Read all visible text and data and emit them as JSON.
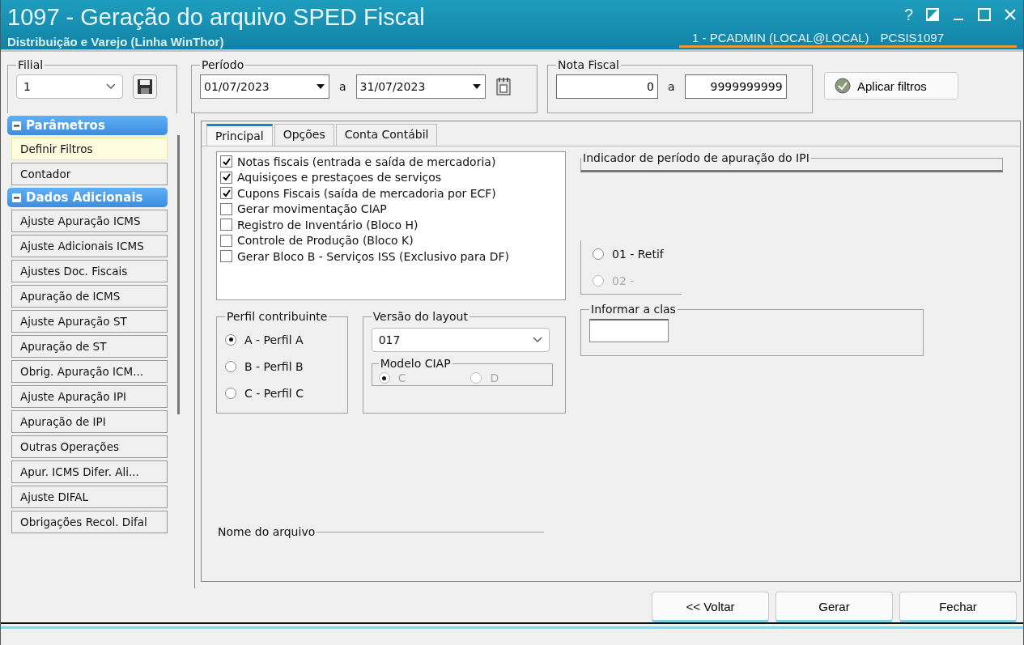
{
  "window": {
    "title": "1097 - Geração do arquivo SPED Fiscal",
    "subtitle": "Distribuição e Varejo (Linha WinThor)",
    "user": "1 - PCADMIN (LOCAL@LOCAL)",
    "program": "PCSIS1097",
    "help": "?"
  },
  "filters": {
    "filial": {
      "label": "Filial",
      "value": "1"
    },
    "periodo": {
      "label": "Período",
      "from": "01/07/2023",
      "separator": "a",
      "to": "31/07/2023"
    },
    "nota_fiscal": {
      "label": "Nota Fiscal",
      "from": "0",
      "separator": "a",
      "to": "9999999999"
    },
    "apply_button": "Aplicar filtros"
  },
  "sidebar": [
    {
      "title": "Parâmetros",
      "expanded": true,
      "items": [
        {
          "label": "Definir Filtros",
          "selected": true
        },
        {
          "label": "Contador",
          "selected": false
        }
      ]
    },
    {
      "title": "Dados Adicionais",
      "expanded": true,
      "items": [
        {
          "label": "Ajuste Apuração ICMS",
          "selected": false
        },
        {
          "label": "Ajuste Adicionais ICMS",
          "selected": false
        },
        {
          "label": "Ajustes Doc. Fiscais",
          "selected": false
        },
        {
          "label": "Apuração de ICMS",
          "selected": false
        },
        {
          "label": "Ajuste Apuração ST",
          "selected": false
        },
        {
          "label": "Apuração de ST",
          "selected": false
        },
        {
          "label": "Obrig. Apuração ICM...",
          "selected": false
        },
        {
          "label": "Ajuste Apuração IPI",
          "selected": false
        },
        {
          "label": "Apuração de IPI",
          "selected": false
        },
        {
          "label": "Outras Operações",
          "selected": false
        },
        {
          "label": "Apur. ICMS Difer. Ali...",
          "selected": false
        },
        {
          "label": "Ajuste DIFAL",
          "selected": false
        },
        {
          "label": "Obrigações Recol. Difal",
          "selected": false
        }
      ]
    }
  ],
  "tabs": [
    {
      "label": "Principal",
      "selected": true
    },
    {
      "label": "Opções",
      "selected": false
    },
    {
      "label": "Conta Contábil",
      "selected": false
    }
  ],
  "registers": [
    {
      "label": "Notas fiscais (entrada e saída de mercadoria)",
      "checked": true
    },
    {
      "label": "Aquisiçoes e prestaçoes de serviços",
      "checked": true
    },
    {
      "label": "Cupons Fiscais (saída de mercadoria por ECF)",
      "checked": true
    },
    {
      "label": "Gerar movimentação CIAP",
      "checked": false
    },
    {
      "label": "Registro de Inventário (Bloco H)",
      "checked": false
    },
    {
      "label": "Controle de Produção (Bloco K)",
      "checked": false
    },
    {
      "label": "Gerar Bloco B - Serviços ISS (Exclusivo para DF)",
      "checked": false
    }
  ],
  "perfil": {
    "label": "Perfil contribuinte",
    "options": [
      {
        "label": "A - Perfil A",
        "selected": true
      },
      {
        "label": "B - Perfil B",
        "selected": false
      },
      {
        "label": "C - Perfil C",
        "selected": false
      }
    ]
  },
  "layout": {
    "label": "Versão do layout",
    "value": "017",
    "ciap": {
      "label": "Modelo CIAP",
      "options": [
        {
          "label": "C",
          "selected": true,
          "disabled": true
        },
        {
          "label": "D",
          "selected": false,
          "disabled": true
        }
      ]
    }
  },
  "ipi": {
    "label": "Indicador de período de apuração do IPI"
  },
  "finalidade": {
    "options": [
      {
        "label": "01 - Retif",
        "selected": false,
        "disabled": false
      },
      {
        "label": "02 -",
        "selected": false,
        "disabled": true
      }
    ]
  },
  "classificacao": {
    "label": "Informar a clas"
  },
  "file_name": {
    "label": "Nome do arquivo"
  },
  "buttons": [
    "<< Voltar",
    "Gerar",
    "Fechar"
  ]
}
